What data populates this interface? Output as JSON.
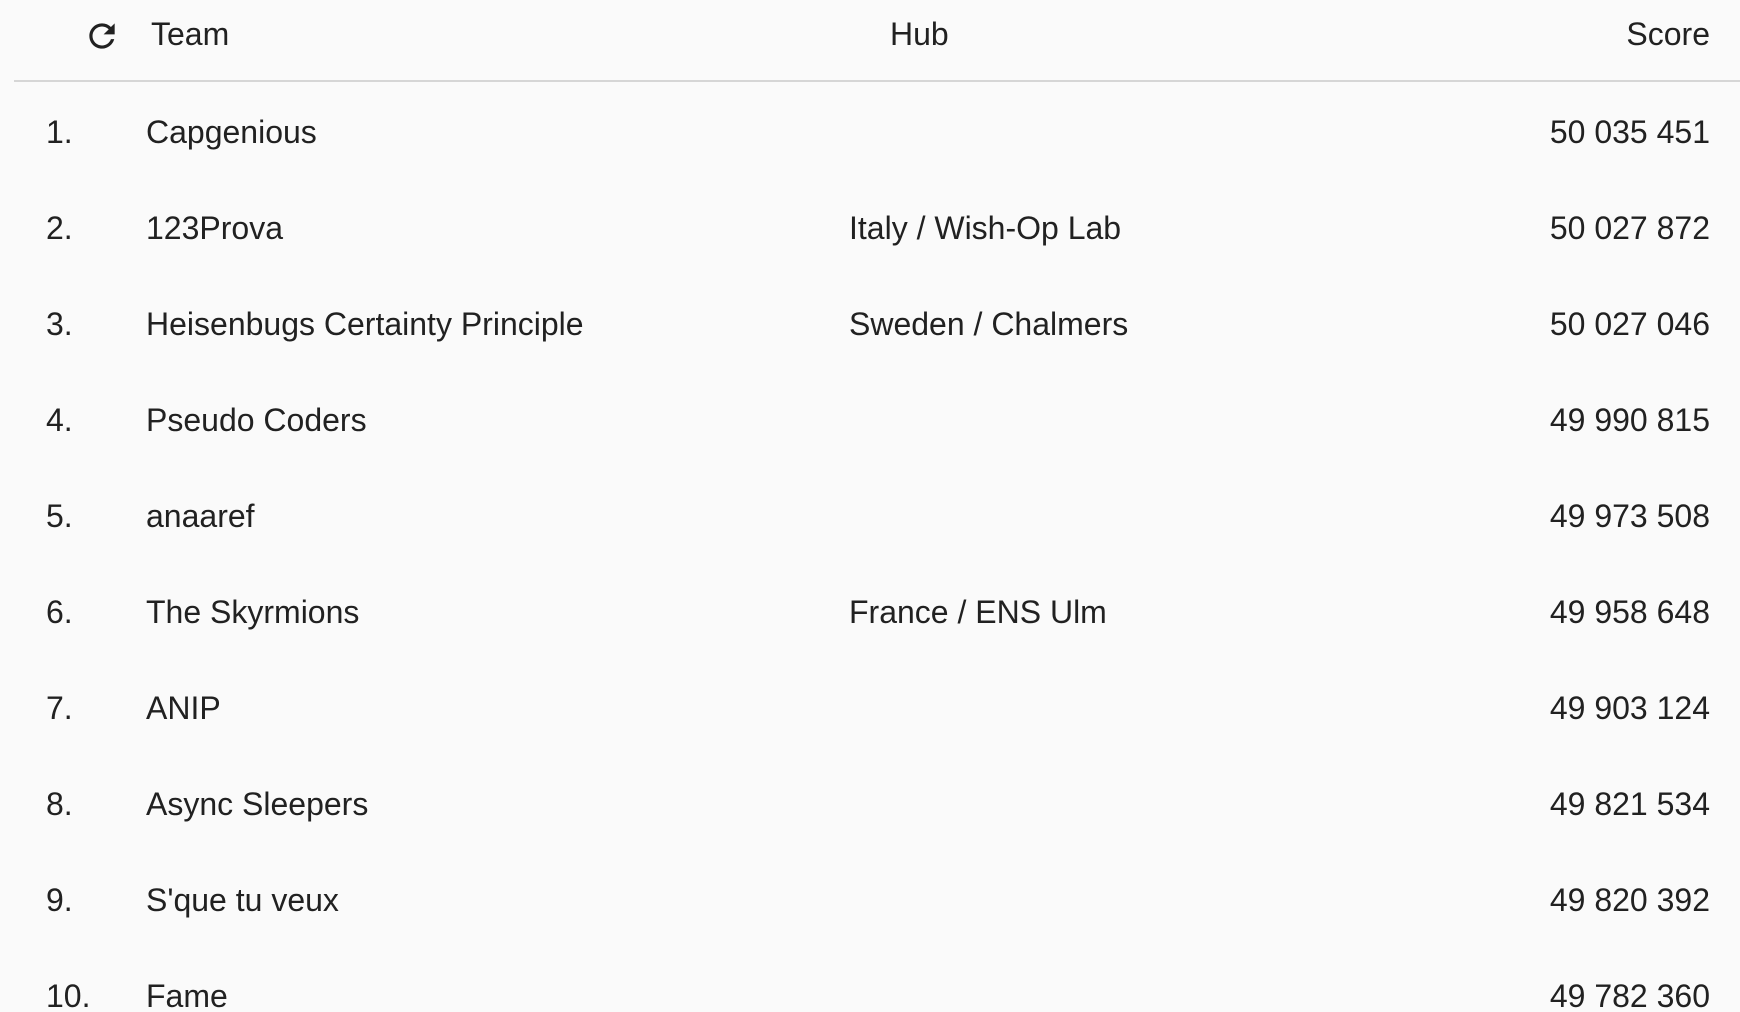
{
  "header": {
    "refresh_icon": "refresh-icon",
    "team_label": "Team",
    "hub_label": "Hub",
    "score_label": "Score"
  },
  "rows": [
    {
      "rank": "1.",
      "team": "Capgenious",
      "hub": "",
      "score": "50 035 451"
    },
    {
      "rank": "2.",
      "team": "123Prova",
      "hub": "Italy / Wish-Op Lab",
      "score": "50 027 872"
    },
    {
      "rank": "3.",
      "team": "Heisenbugs Certainty Principle",
      "hub": "Sweden / Chalmers",
      "score": "50 027 046"
    },
    {
      "rank": "4.",
      "team": "Pseudo Coders",
      "hub": "",
      "score": "49 990 815"
    },
    {
      "rank": "5.",
      "team": "anaaref",
      "hub": "",
      "score": "49 973 508"
    },
    {
      "rank": "6.",
      "team": "The Skyrmions",
      "hub": "France / ENS Ulm",
      "score": "49 958 648"
    },
    {
      "rank": "7.",
      "team": "ANIP",
      "hub": "",
      "score": "49 903 124"
    },
    {
      "rank": "8.",
      "team": "Async Sleepers",
      "hub": "",
      "score": "49 821 534"
    },
    {
      "rank": "9.",
      "team": "S'que tu veux",
      "hub": "",
      "score": "49 820 392"
    },
    {
      "rank": "10.",
      "team": "Fame",
      "hub": "",
      "score": "49 782 360"
    }
  ]
}
